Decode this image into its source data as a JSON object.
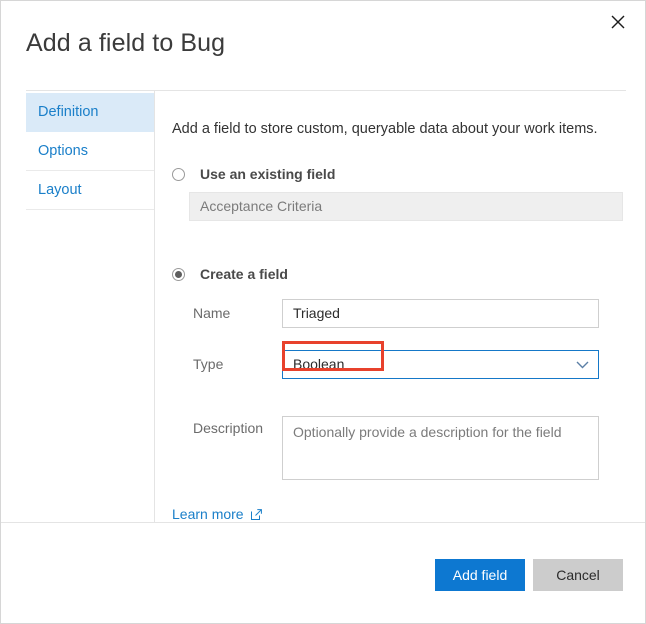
{
  "dialog": {
    "title": "Add a field to Bug",
    "close_icon": "close-icon"
  },
  "tabs": [
    {
      "label": "Definition",
      "selected": true
    },
    {
      "label": "Options",
      "selected": false
    },
    {
      "label": "Layout",
      "selected": false
    }
  ],
  "content": {
    "intro": "Add a field to store custom, queryable data about your work items.",
    "existing": {
      "radio_label": "Use an existing field",
      "selected": false,
      "field_value": "Acceptance Criteria"
    },
    "create": {
      "radio_label": "Create a field",
      "selected": true,
      "name": {
        "label": "Name",
        "value": "Triaged",
        "placeholder": "Name"
      },
      "type": {
        "label": "Type",
        "value": "Boolean",
        "chevron_icon": "chevron-down-icon"
      },
      "description": {
        "label": "Description",
        "value": "",
        "placeholder": "Optionally provide a description for the field"
      }
    },
    "learn_more": {
      "label": "Learn more",
      "icon": "external-link-icon"
    }
  },
  "footer": {
    "primary_label": "Add field",
    "secondary_label": "Cancel"
  },
  "colors": {
    "accent": "#0d78d1",
    "link": "#1a7fc9",
    "tab_selected_bg": "#daeaf8",
    "annotation": "#e8412c",
    "focus_border": "#1578c8"
  }
}
